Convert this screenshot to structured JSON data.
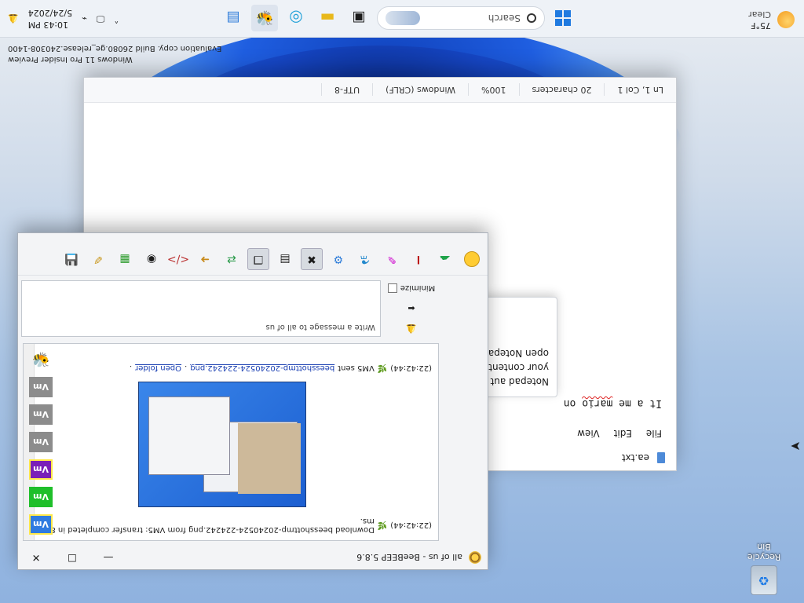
{
  "desktop": {
    "watermark_line1": "Windows 11 Pro Insider Preview",
    "watermark_line2": "Evaluation copy. Build 26080.ge_release.240308-1400",
    "recycle_bin_label": "Recycle Bin"
  },
  "taskbar": {
    "temperature": "75°F",
    "condition": "Clear",
    "search_placeholder": "Search",
    "time": "10:43 PM",
    "date": "5/24/2024",
    "apps": [
      "start-icon",
      "search-icon",
      "file-explorer-icon",
      "edge-icon",
      "file-manager-icon",
      "beebeep-icon",
      "notepad-icon",
      "terminal-icon"
    ]
  },
  "notepad": {
    "tab_title": "ea.txt",
    "menu": [
      "File",
      "Edit",
      "View"
    ],
    "text_before": "It a me ",
    "text_misspelled": "mario",
    "text_after": " on",
    "tooltip_lines": [
      "Notepad aut",
      "your content",
      "open Notepa"
    ],
    "status": {
      "position": "Ln 1, Col 1",
      "characters": "20 characters",
      "zoom": "100%",
      "line_ending": "Windows (CRLF)",
      "encoding": "UTF-8"
    }
  },
  "beebeep": {
    "title": "all of us - BeeBEEP 5.8.6",
    "users": [
      {
        "label": "Vm",
        "color": "#2f7be0",
        "border": "#ffe84a"
      },
      {
        "label": "Vm",
        "color": "#1fbf2a",
        "border": "#1fbf2a"
      },
      {
        "label": "Vm",
        "color": "#7a1fb8",
        "border": "#ffe84a"
      },
      {
        "label": "Vm",
        "color": "#8c8c8c",
        "border": "#8c8c8c"
      },
      {
        "label": "Vm",
        "color": "#8c8c8c",
        "border": "#8c8c8c"
      },
      {
        "label": "Vm",
        "color": "#8c8c8c",
        "border": "#8c8c8c"
      }
    ],
    "chat": {
      "msg1_time": "(22:42:44)",
      "msg1_text": "Download beesshottmp-20240524-224242.png from VM5: transfer completed in 85 ms.",
      "msg2_time": "(22:42:44)",
      "msg2_prefix": "VM5 sent ",
      "msg2_file": "beesshottmp-20240524-224242.png",
      "msg2_sep": ". ",
      "msg2_open": "Open folder",
      "msg2_end": "."
    },
    "input_placeholder": "Write a message to all of us",
    "minimize_label": "Minimize",
    "toolbar_icons": [
      "emoticon-icon",
      "cloud-icon",
      "font-icon",
      "color-icon",
      "spell-check-icon",
      "settings-icon",
      "clear-icon",
      "note-icon",
      "copy-icon",
      "share-icon",
      "arrow-icon",
      "code-icon",
      "webcam-icon",
      "screenshot-icon",
      "edit-icon",
      "save-icon"
    ]
  }
}
